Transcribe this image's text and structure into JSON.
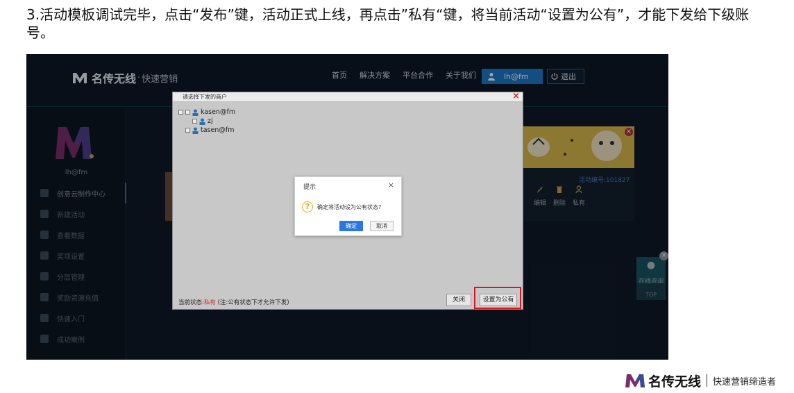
{
  "instruction": {
    "text": "3.活动模板调试完毕，点击“发布”键，活动正式上线，再点击”私有“键，将当前活动“设置为公有”，才能下发给下级账号。"
  },
  "app": {
    "brand_name": "名传无线",
    "brand_dot": "·",
    "brand_sub": "快速营销",
    "nav": [
      "首页",
      "解决方案",
      "平台合作",
      "关于我们"
    ],
    "user": "lh@fm",
    "logout": "退出"
  },
  "sidebar": {
    "username": "lh@fm",
    "items": [
      {
        "label": "创意云制作中心"
      },
      {
        "label": "新建活动"
      },
      {
        "label": "查看数据"
      },
      {
        "label": "奖项设置"
      },
      {
        "label": "分层管理"
      },
      {
        "label": "奖励资源充值"
      },
      {
        "label": "快速入门"
      },
      {
        "label": "成功案例"
      }
    ]
  },
  "promo_card": {
    "activity_id": "活动编号:101827",
    "actions": [
      "编辑",
      "删除",
      "私有"
    ]
  },
  "float_help": {
    "label": "在线咨询",
    "top": "TOP"
  },
  "dispatch_modal": {
    "title": "请选择下发的商户",
    "tree": [
      {
        "label": "kasen@fm",
        "level": 0
      },
      {
        "label": "zj",
        "level": 1
      },
      {
        "label": "tasen@fm",
        "level": 0
      }
    ],
    "status_prefix": "当前状态:",
    "status_value": "私有",
    "status_note": " (注:公有状态下才允许下发)",
    "close_button": "关闭",
    "public_button": "设置为公有"
  },
  "confirm_dialog": {
    "title": "提示",
    "message": "确定将活动设为公有状态?",
    "ok": "确定",
    "cancel": "取消"
  },
  "footer": {
    "brand_name": "名传无线",
    "slogan": "快速营销缔造者"
  },
  "colors": {
    "primary_blue": "#1d78c9",
    "highlight_red": "#e0121b",
    "warning": "#f0a020"
  }
}
